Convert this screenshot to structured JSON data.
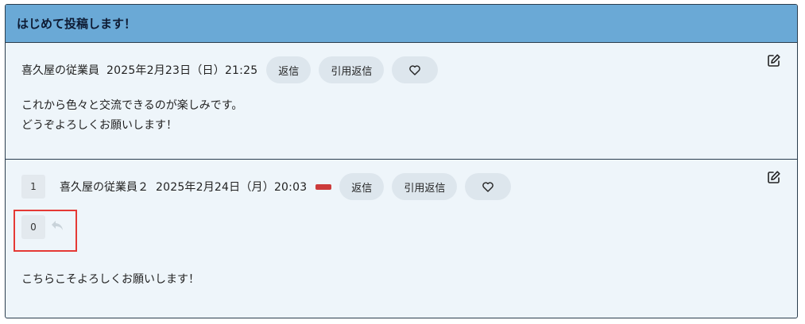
{
  "thread": {
    "title": "はじめて投稿します！"
  },
  "posts": [
    {
      "author": "喜久屋の従業員",
      "date": "2025年2月23日（日）21:25",
      "reply_label": "返信",
      "quote_reply_label": "引用返信",
      "body_lines": [
        "これから色々と交流できるのが楽しみです。",
        "どうぞよろしくお願いします！"
      ]
    },
    {
      "number": "1",
      "author": "喜久屋の従業員２",
      "date": "2025年2月24日（月）20:03",
      "reply_label": "返信",
      "quote_reply_label": "引用返信",
      "reply_count": "0",
      "body_lines": [
        "こちらこそよろしくお願いします！"
      ]
    }
  ],
  "icons": {
    "like": "heart-icon",
    "edit": "edit-icon",
    "reply": "reply-arrow-icon"
  },
  "colors": {
    "header_bg": "#6aa9d6",
    "post_bg": "#eef5fa",
    "pill_bg": "#dde6ed",
    "tag": "#cc3b3b",
    "highlight_border": "#e53935"
  }
}
